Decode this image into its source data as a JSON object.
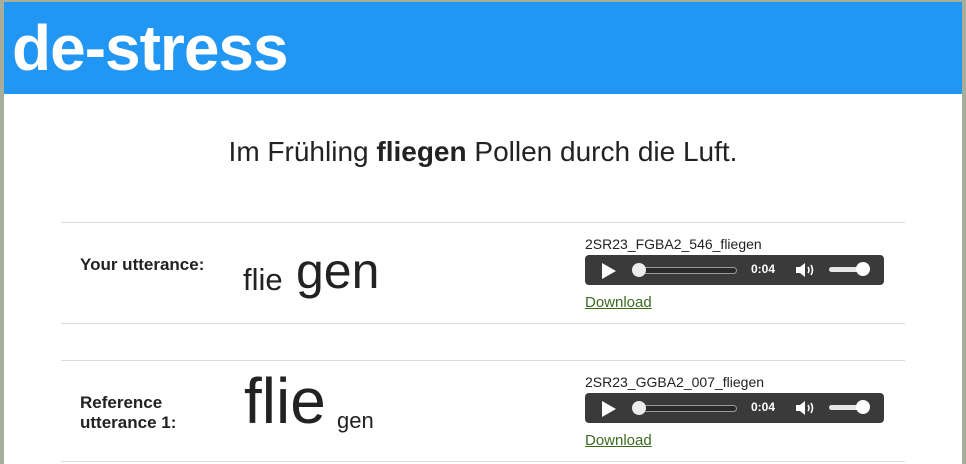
{
  "header": {
    "logo": "de-stress",
    "color": "#2196f3"
  },
  "sentence": {
    "before": "Im Frühling ",
    "highlight": "fliegen",
    "after": " Pollen durch die Luft."
  },
  "rows": [
    {
      "label": "Your utterance:",
      "syllables": [
        {
          "text": "flie",
          "stress": "weak"
        },
        {
          "text": "gen",
          "stress": "strong"
        }
      ],
      "file": "2SR23_FGBA2_546_fliegen",
      "player": {
        "time": "0:04",
        "progress": 0.0,
        "volume": 1.0
      },
      "download": "Download"
    },
    {
      "label": "Reference utterance 1:",
      "syllables": [
        {
          "text": "flie",
          "stress": "strong"
        },
        {
          "text": "gen",
          "stress": "weak"
        }
      ],
      "file": "2SR23_GGBA2_007_fliegen",
      "player": {
        "time": "0:04",
        "progress": 0.0,
        "volume": 1.0
      },
      "download": "Download"
    }
  ],
  "icons": {
    "play": "play-icon",
    "volume": "speaker-icon"
  }
}
